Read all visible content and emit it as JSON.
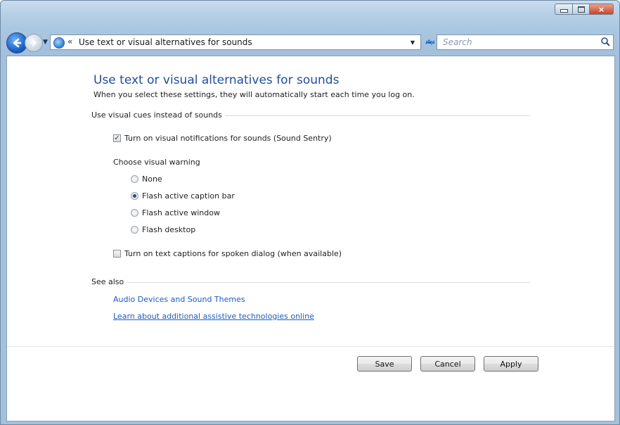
{
  "window": {
    "caption_buttons": {
      "minimize": "minimize",
      "maximize": "maximize",
      "close": "×"
    }
  },
  "nav": {
    "breadcrumb_separator": "«",
    "address": "Use text or visual alternatives for sounds",
    "search_placeholder": "Search"
  },
  "page": {
    "title": "Use text or visual alternatives for sounds",
    "subtitle": "When you select these settings, they will automatically start each time you log on."
  },
  "visual_cues": {
    "section_label": "Use visual cues instead of sounds",
    "sound_sentry": {
      "label": "Turn on visual notifications for sounds (Sound Sentry)",
      "checked": true
    },
    "warning_label": "Choose visual warning",
    "warning_options": [
      {
        "label": "None",
        "selected": false
      },
      {
        "label": "Flash active caption bar",
        "selected": true
      },
      {
        "label": "Flash active window",
        "selected": false
      },
      {
        "label": "Flash desktop",
        "selected": false
      }
    ],
    "text_captions": {
      "label": "Turn on text captions for spoken dialog (when available)",
      "checked": false
    }
  },
  "see_also": {
    "section_label": "See also",
    "links": [
      "Audio Devices and Sound Themes",
      "Learn about additional assistive technologies online"
    ]
  },
  "buttons": {
    "save": "Save",
    "cancel": "Cancel",
    "apply": "Apply"
  },
  "colors": {
    "link": "#1c5bbf",
    "title": "#1e4e9a",
    "frame": "#aac7e2"
  },
  "icons": {
    "back": "back-arrow-icon",
    "forward": "forward-arrow-icon",
    "control_panel": "control-panel-icon",
    "refresh": "refresh-icon",
    "search": "search-icon"
  }
}
